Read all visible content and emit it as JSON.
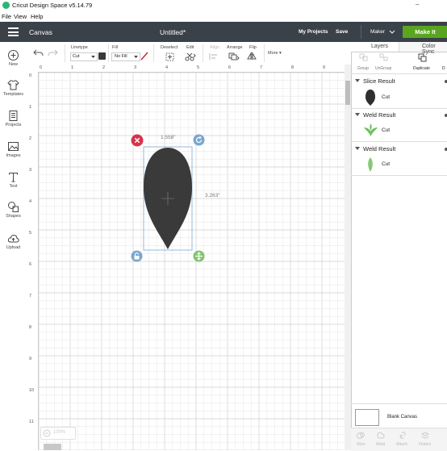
{
  "window": {
    "title": "Cricut Design Space  v5.14.79",
    "minimize": "–",
    "close": "×"
  },
  "menubar": {
    "items": [
      "File",
      "View",
      "Help"
    ]
  },
  "header": {
    "canvas_label": "Canvas",
    "doc_title": "Untitled*",
    "my_projects": "My Projects",
    "save": "Save",
    "machine": "Maker",
    "make_it": "Make It",
    "colors": {
      "bar": "#3a4149",
      "make_it": "#5aa520"
    }
  },
  "sidebar": {
    "items": [
      {
        "label": "New",
        "icon": "plus-icon"
      },
      {
        "label": "Templates",
        "icon": "shirt-icon"
      },
      {
        "label": "Projects",
        "icon": "projects-icon"
      },
      {
        "label": "Images",
        "icon": "image-icon"
      },
      {
        "label": "Text",
        "icon": "text-icon"
      },
      {
        "label": "Shapes",
        "icon": "shapes-icon"
      },
      {
        "label": "Upload",
        "icon": "cloud-upload-icon"
      }
    ]
  },
  "toolbar": {
    "linetype_label": "Linetype",
    "linetype_value": "Cut",
    "fill_label": "Fill",
    "fill_value": "No Fill",
    "deselect": "Deselect",
    "edit": "Edit",
    "align": "Align",
    "arrange": "Arrange",
    "flip": "Flip",
    "more": "More ▾",
    "swatch_color": "#3a3a3a"
  },
  "canvas": {
    "ruler_top": [
      "0",
      "1",
      "2",
      "3",
      "4",
      "5",
      "6",
      "7",
      "8",
      "9"
    ],
    "ruler_left": [
      "0",
      "1",
      "2",
      "3",
      "4",
      "5",
      "6",
      "7",
      "8",
      "9",
      "10",
      "11"
    ],
    "selection_width": "1.558\"",
    "selection_height": "3.263\"",
    "shape_color": "#3a3a3a",
    "handle_colors": {
      "delete": "#d8334a",
      "rotate": "#7ba7cf",
      "lock": "#7ba7cf",
      "resize": "#7fc56b"
    },
    "zoom": "100%"
  },
  "right_panel": {
    "tabs": [
      "Layers",
      "Color Sync"
    ],
    "tools": [
      "Group",
      "UnGroup",
      "Duplicate",
      "D"
    ],
    "groups": [
      {
        "name": "Slice Result",
        "item_label": "Cut",
        "thumb_color": "#2f2f2f"
      },
      {
        "name": "Weld Result",
        "item_label": "Cut",
        "thumb_color": "#6cbf5c"
      },
      {
        "name": "Weld Result",
        "item_label": "Cut",
        "thumb_color": "#8fd07f"
      }
    ],
    "blank_canvas": "Blank Canvas",
    "bottom_tools": [
      "Slice",
      "Weld",
      "Attach",
      "Flatten"
    ]
  }
}
